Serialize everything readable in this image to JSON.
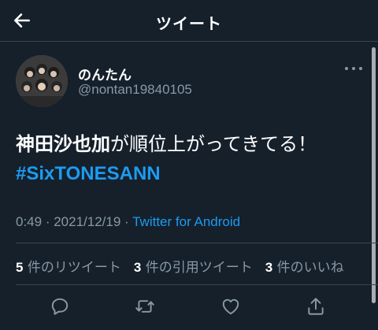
{
  "header": {
    "title": "ツイート"
  },
  "tweet": {
    "display_name": "のんたん",
    "username": "@nontan19840105",
    "text_bold": "神田沙也加",
    "text_rest": "が順位上がってきてる！",
    "hashtag": "#SixTONESANN",
    "time": "0:49",
    "separator1": " · ",
    "date": "2021/12/19",
    "separator2": " · ",
    "source": "Twitter for Android"
  },
  "stats": {
    "retweets_count": "5",
    "retweets_label": "件のリツイート",
    "quotes_count": "3",
    "quotes_label": "件の引用ツイート",
    "likes_count": "3",
    "likes_label": "件のいいね"
  },
  "colors": {
    "background": "#15202b",
    "accent": "#1d9bf0",
    "secondary_text": "#8899a6",
    "divider": "#38444d"
  },
  "icons": [
    "back-arrow-icon",
    "more-icon",
    "reply-icon",
    "retweet-icon",
    "like-icon",
    "share-icon"
  ]
}
